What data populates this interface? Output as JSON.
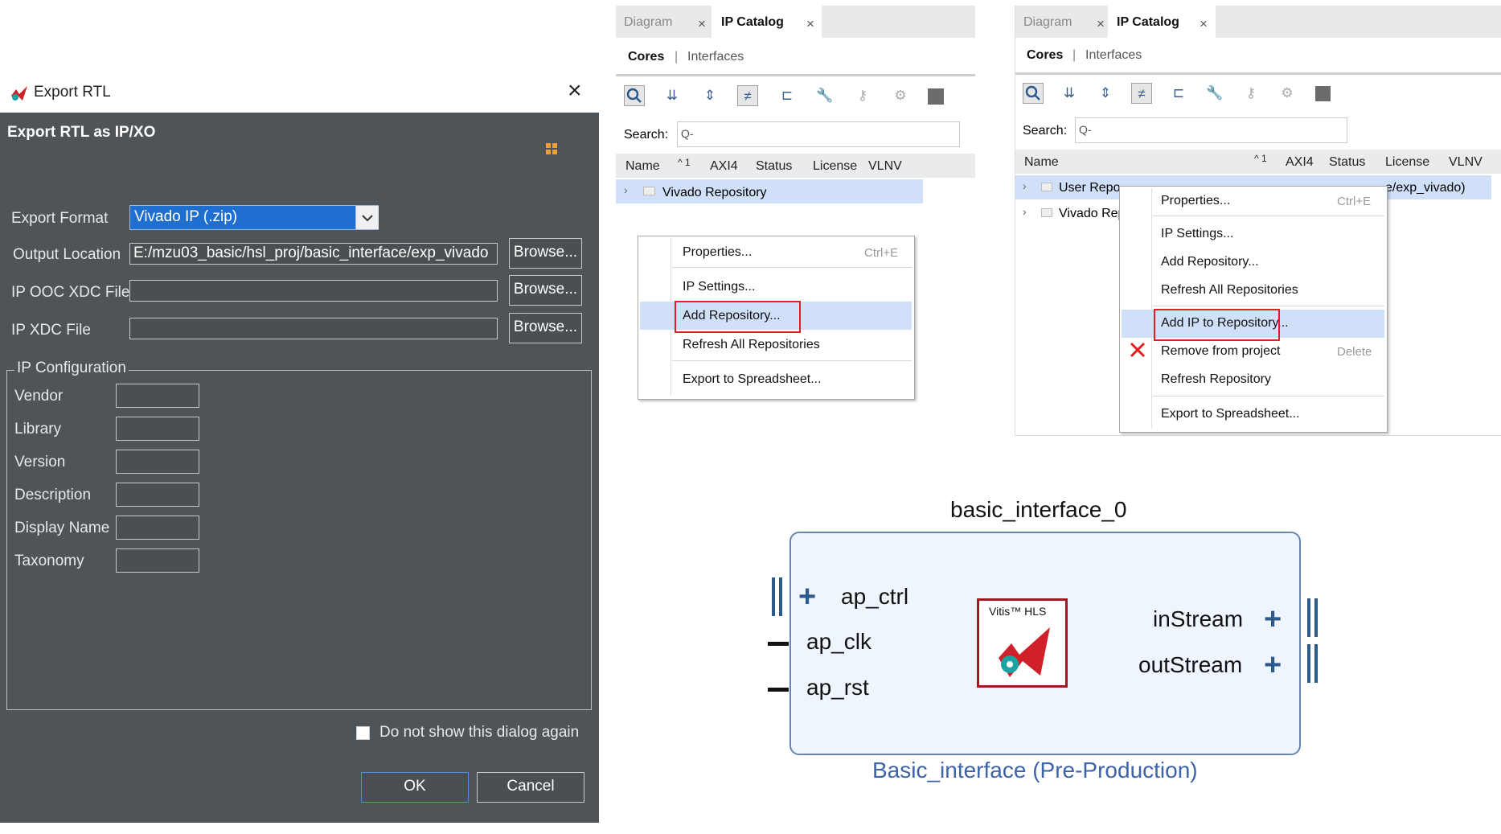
{
  "export_dialog": {
    "title": "Export RTL",
    "header": "Export RTL as IP/XO",
    "close": "×",
    "export_format_label": "Export Format",
    "export_format_value": "Vivado IP (.zip)",
    "output_location_label": "Output Location",
    "output_location_value": "E:/mzu03_basic/hsl_proj/basic_interface/exp_vivado",
    "ip_ooc_xdc_label": "IP OOC XDC File",
    "ip_xdc_label": "IP XDC File",
    "browse_label": "Browse...",
    "ip_config_legend": "IP Configuration",
    "config_fields": [
      "Vendor",
      "Library",
      "Version",
      "Description",
      "Display Name",
      "Taxonomy"
    ],
    "dont_show_label": "Do not show this dialog again",
    "ok_label": "OK",
    "cancel_label": "Cancel"
  },
  "catalog_left": {
    "tabs": [
      "Diagram",
      "IP Catalog"
    ],
    "subtabs": [
      "Cores",
      "Interfaces"
    ],
    "subtab_sep": "|",
    "search_label": "Search:",
    "search_placeholder": "Q-",
    "columns": [
      "Name",
      "^ 1",
      "AXI4",
      "Status",
      "License",
      "VLNV"
    ],
    "rows": [
      "Vivado Repository"
    ],
    "context_menu": [
      {
        "label": "Properties...",
        "shortcut": "Ctrl+E"
      },
      {
        "label": "IP Settings...",
        "shortcut": ""
      },
      {
        "label": "Add Repository...",
        "shortcut": ""
      },
      {
        "label": "Refresh All Repositories",
        "shortcut": ""
      },
      {
        "label": "Export to Spreadsheet...",
        "shortcut": ""
      }
    ]
  },
  "catalog_right": {
    "tabs": [
      "Diagram",
      "IP Catalog"
    ],
    "subtabs": [
      "Cores",
      "Interfaces"
    ],
    "subtab_sep": "|",
    "search_label": "Search:",
    "search_placeholder": "Q-",
    "columns": [
      "Name",
      "^ 1",
      "AXI4",
      "Status",
      "License",
      "VLNV"
    ],
    "rows": [
      "User Repo",
      "Vivado Rep"
    ],
    "row0_tail": "e/exp_vivado)",
    "context_menu": [
      {
        "label": "Properties...",
        "shortcut": "Ctrl+E"
      },
      {
        "label": "IP Settings...",
        "shortcut": ""
      },
      {
        "label": "Add Repository...",
        "shortcut": ""
      },
      {
        "label": "Refresh All Repositories",
        "shortcut": ""
      },
      {
        "label": "Add IP to Repository...",
        "shortcut": ""
      },
      {
        "label": "Remove from project",
        "shortcut": "Delete"
      },
      {
        "label": "Refresh Repository",
        "shortcut": ""
      },
      {
        "label": "Export to Spreadsheet...",
        "shortcut": ""
      }
    ]
  },
  "ip_block": {
    "instance_name": "basic_interface_0",
    "ports_left": [
      "ap_ctrl",
      "ap_clk",
      "ap_rst"
    ],
    "ports_right": [
      "inStream",
      "outStream"
    ],
    "logo_text": "Vitis™ HLS",
    "caption": "Basic_interface (Pre-Production)"
  },
  "icons": {
    "close": "close-icon",
    "search": "search-icon",
    "remove": "red-x-icon",
    "plus": "plus-icon"
  },
  "colors": {
    "dialog_bg": "#4e5457",
    "select_blue": "#1f6fd0",
    "highlight": "#cfe0f8",
    "red_box": "#e02020",
    "block_border": "#6688b0",
    "caption_blue": "#3d63a8"
  }
}
